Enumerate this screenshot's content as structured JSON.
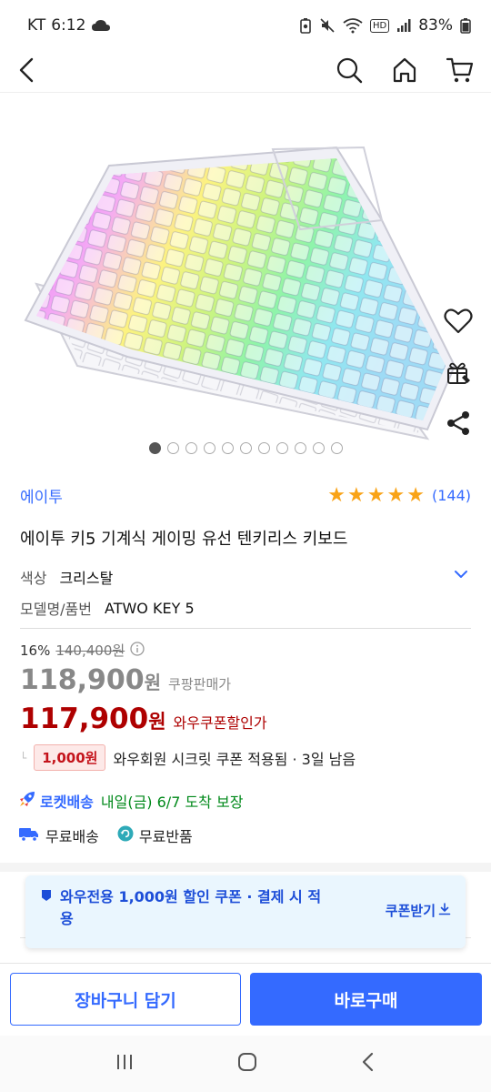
{
  "status": {
    "carrier": "KT",
    "time": "6:12",
    "battery": "83%",
    "icons": [
      "cloud-icon",
      "battery-saver-icon",
      "mute-icon",
      "wifi-icon",
      "hd-icon",
      "signal-icon",
      "battery-icon"
    ],
    "hd_label": "HD"
  },
  "topnav": {
    "icons": [
      "back-icon",
      "search-icon",
      "home-icon",
      "cart-icon"
    ]
  },
  "gallery": {
    "image_subject": "transparent mechanical keyboard with rainbow RGB backlight",
    "image_count": 11,
    "active_index": 0,
    "side_actions": [
      "heart-icon",
      "gift-icon",
      "share-icon"
    ]
  },
  "product": {
    "brand": "에이투",
    "rating": 5,
    "review_count": "(144)",
    "title": "에이투 키5 기계식 게이밍 유선 텐키리스 키보드",
    "options": [
      {
        "key": "색상",
        "value": "크리스탈"
      },
      {
        "key": "모델명/품번",
        "value": "ATWO KEY 5"
      }
    ]
  },
  "pricing": {
    "discount_rate": "16%",
    "original_price": "140,400원",
    "sale_price": "118,900",
    "sale_won": "원",
    "sale_label": "쿠팡판매가",
    "wow_price": "117,900",
    "wow_won": "원",
    "wow_label": "와우쿠폰할인가",
    "coupon_amount": "1,000원",
    "coupon_desc": "와우회원 시크릿 쿠폰 적용됨 · 3일 남음"
  },
  "delivery": {
    "rocket_brand": "로켓배송",
    "rocket_text": "내일(금) 6/7 도착 보장",
    "free_shipping": "무료배송",
    "free_return": "무료반품"
  },
  "banner": {
    "text": "와우전용 1,000원 할인 쿠폰 · 결제 시 적용",
    "cta": "쿠폰받기"
  },
  "actions": {
    "add_to_cart": "장바구니 담기",
    "buy_now": "바로구매"
  },
  "colors": {
    "accent": "#346aff",
    "price_red": "#ae0000",
    "rocket_green": "#00891a",
    "star": "#f9a317",
    "banner_bg": "#eaf6fe"
  },
  "android_nav": [
    "recents-icon",
    "home-circle-icon",
    "back-chevron-icon"
  ]
}
